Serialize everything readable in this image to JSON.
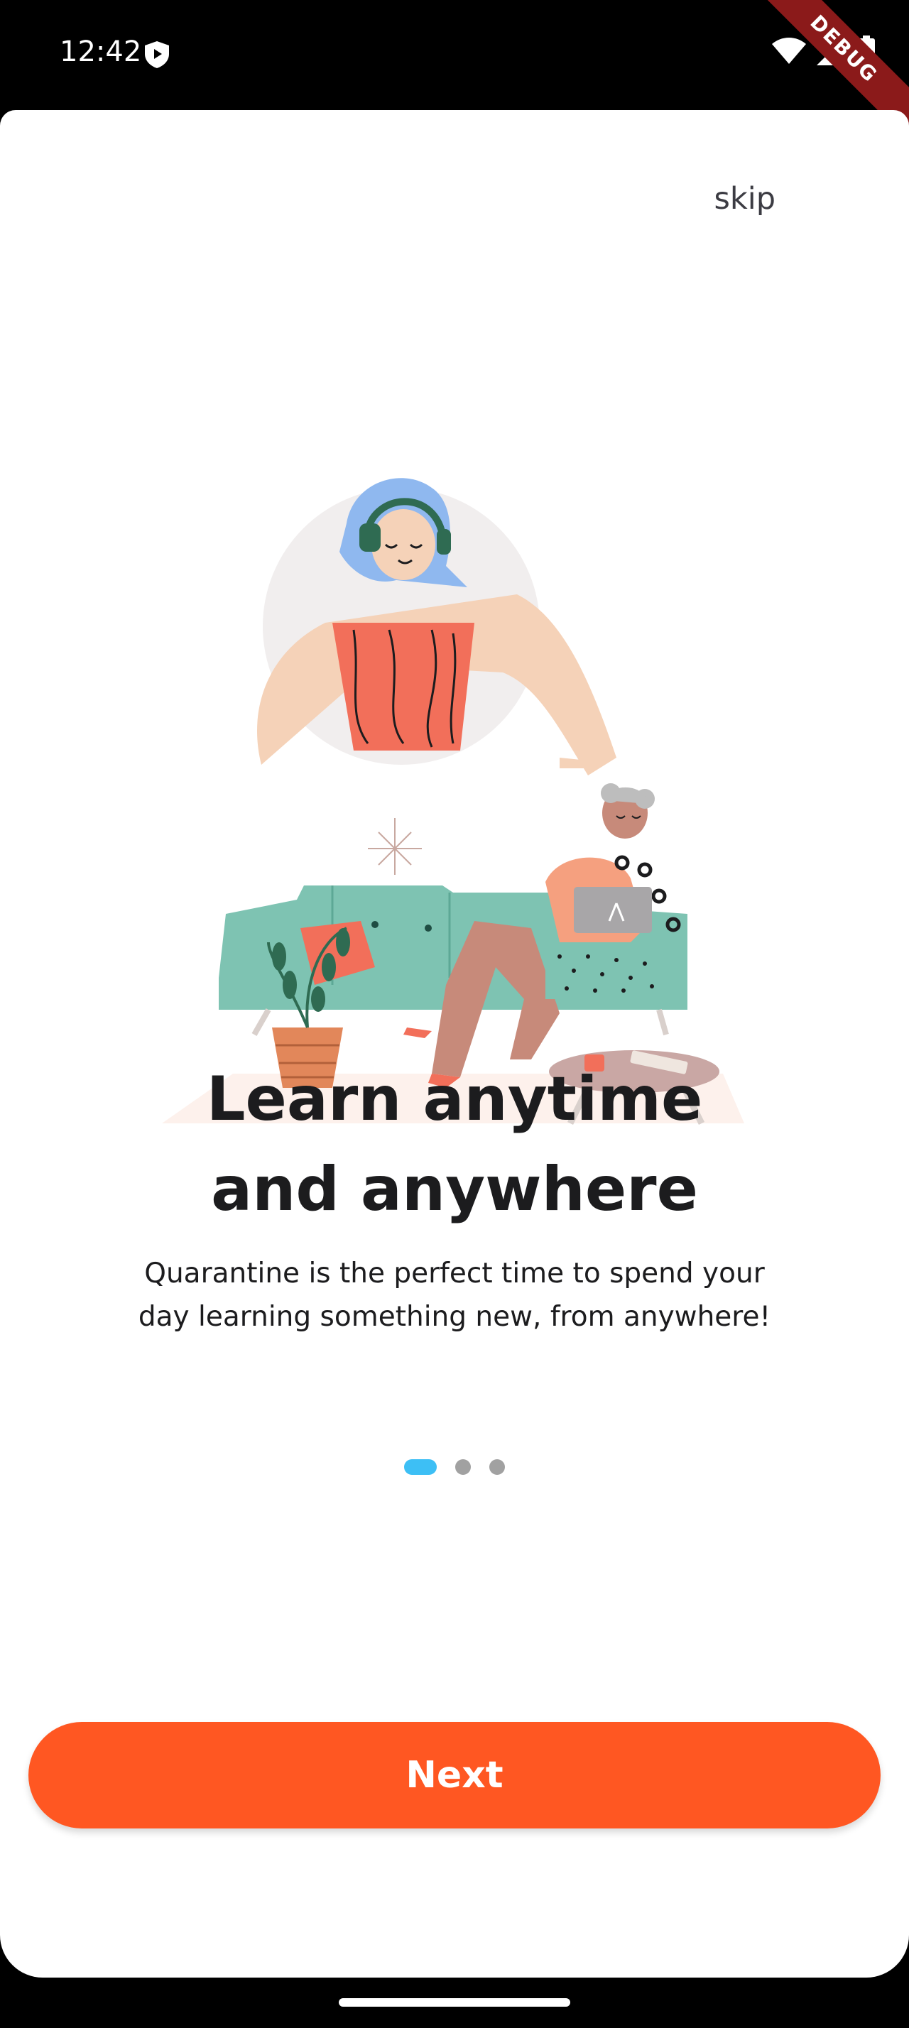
{
  "status_bar": {
    "time": "12:42",
    "debug_label": "DEBUG",
    "icons": [
      "shield-icon",
      "wifi-icon",
      "cell-signal-icon",
      "battery-icon"
    ]
  },
  "onboarding": {
    "skip_label": "skip",
    "title_line1": "Learn anytime",
    "title_line2": "and anywhere",
    "subtitle_line1": "Quarantine is the perfect time to spend your",
    "subtitle_line2": "day learning something new, from anywhere!",
    "page_indicator": {
      "total": 3,
      "active": 1
    },
    "next_label": "Next"
  },
  "colors": {
    "accent": "#ff5722",
    "indicator_active": "#3dbff5",
    "indicator_inactive": "#a1a1a1",
    "text": "#1c1c1e"
  }
}
